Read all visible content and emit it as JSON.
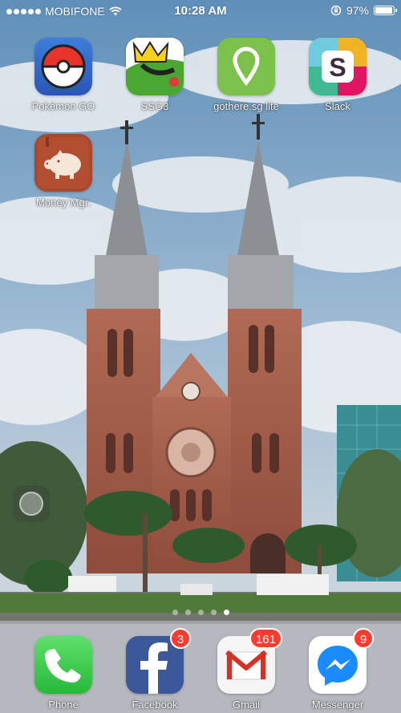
{
  "status_bar": {
    "carrier": "MOBIFONE",
    "time": "10:28 AM",
    "battery_percent": "97%",
    "battery_level": 0.97
  },
  "home_apps": [
    {
      "label": "Pokémon GO",
      "icon": "pokeball-icon"
    },
    {
      "label": "SSG3",
      "icon": "ssg3-crown-icon"
    },
    {
      "label": "gothere.sg lite",
      "icon": "map-pin-icon"
    },
    {
      "label": "Slack",
      "icon": "slack-icon"
    },
    {
      "label": "Money Mgr.",
      "icon": "piggy-bank-icon"
    }
  ],
  "page_indicator": {
    "pages": 5,
    "current": 5
  },
  "dock": [
    {
      "label": "Phone",
      "icon": "phone-icon",
      "badge": ""
    },
    {
      "label": "Facebook",
      "icon": "facebook-icon",
      "badge": "3"
    },
    {
      "label": "Gmail",
      "icon": "gmail-icon",
      "badge": "161"
    },
    {
      "label": "Messenger",
      "icon": "messenger-icon",
      "badge": "9"
    }
  ]
}
